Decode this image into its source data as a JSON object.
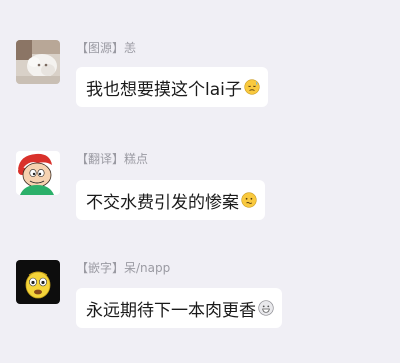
{
  "messages": [
    {
      "sender": "【图源】恙",
      "text": "我也想要摸这个lai子",
      "emoji": "sweating-face-icon"
    },
    {
      "sender": "【翻译】糕点",
      "text": "不交水费引发的惨案",
      "emoji": "confused-face-icon"
    },
    {
      "sender": "【嵌字】呆/napp",
      "text": "永远期待下一本肉更香",
      "emoji": "grinning-face-icon"
    }
  ]
}
